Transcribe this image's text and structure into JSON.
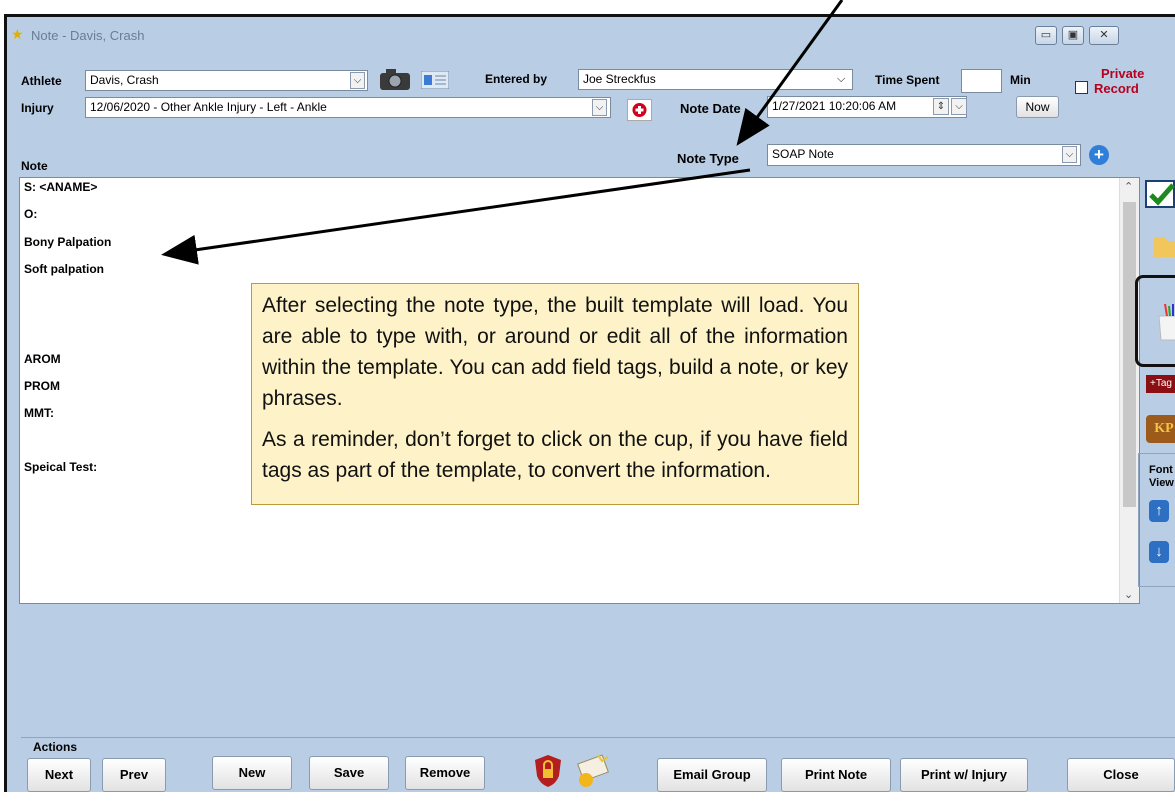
{
  "window": {
    "title": "Note - Davis, Crash"
  },
  "form": {
    "athlete_label": "Athlete",
    "athlete_value": "Davis, Crash",
    "entered_by_label": "Entered by",
    "entered_by_value": "Joe Streckfus",
    "time_spent_label": "Time Spent",
    "time_spent_value": "",
    "min_label": "Min",
    "private_label": "Private",
    "record_label": "Record",
    "injury_label": "Injury",
    "injury_value": "12/06/2020 - Other Ankle Injury - Left - Ankle",
    "note_date_label": "Note Date",
    "note_date_value": "1/27/2021 10:20:06 AM",
    "now_label": "Now",
    "note_type_label": "Note Type",
    "note_type_value": "SOAP Note",
    "note_label": "Note"
  },
  "note_lines": [
    "S:  <ANAME>",
    "O:",
    "Bony Palpation",
    "Soft palpation",
    "AROM",
    "PROM",
    "MMT:",
    "Speical Test:"
  ],
  "callout": {
    "paragraph1": "After selecting the note type, the built template will load. You are able to type with, or around or edit all of the information within the template.  You can add field tags, build a note, or key phrases.",
    "paragraph2": "As a reminder, don’t forget to click on the cup, if you have field tags as part of the template, to convert the information."
  },
  "sidebar": {
    "tag_label": "+Tag",
    "kp_label": "KP",
    "font_label": "Font",
    "view_label": "View"
  },
  "actions": {
    "label": "Actions",
    "next": "Next",
    "prev": "Prev",
    "new": "New",
    "save": "Save",
    "remove": "Remove",
    "email_group": "Email Group",
    "print_note": "Print Note",
    "print_injury": "Print w/ Injury",
    "close": "Close"
  },
  "colors": {
    "window_bg": "#b9cde5",
    "callout_bg": "#fdf2c8",
    "private_text": "#b8001f"
  }
}
